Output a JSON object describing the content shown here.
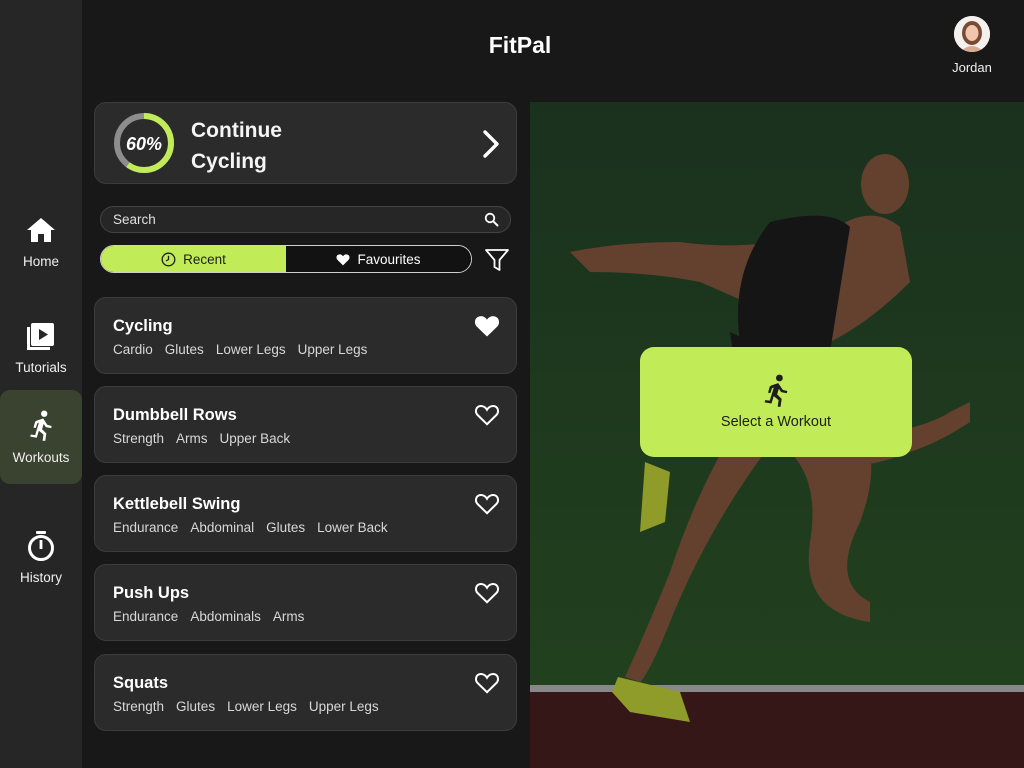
{
  "app": {
    "title": "FitPal"
  },
  "user": {
    "name": "Jordan",
    "avatar_icon": "avatar-portrait"
  },
  "sidebar": {
    "items": [
      {
        "label": "Home",
        "icon": "home-icon",
        "active": false
      },
      {
        "label": "Tutorials",
        "icon": "video-icon",
        "active": false
      },
      {
        "label": "Workouts",
        "icon": "running-icon",
        "active": true
      },
      {
        "label": "History",
        "icon": "stopwatch-icon",
        "active": false
      }
    ]
  },
  "continue_card": {
    "progress_percent": 60,
    "progress_label": "60%",
    "line1": "Continue",
    "line2": "Cycling"
  },
  "search": {
    "placeholder": "Search"
  },
  "tabs": {
    "recent_label": "Recent",
    "favourites_label": "Favourites",
    "active": "Recent"
  },
  "workouts": [
    {
      "name": "Cycling",
      "tags": [
        "Cardio",
        "Glutes",
        "Lower Legs",
        "Upper Legs"
      ],
      "favourite": true
    },
    {
      "name": "Dumbbell Rows",
      "tags": [
        "Strength",
        "Arms",
        "Upper Back"
      ],
      "favourite": false
    },
    {
      "name": "Kettlebell Swing",
      "tags": [
        "Endurance",
        "Abdominal",
        "Glutes",
        "Lower Back"
      ],
      "favourite": false
    },
    {
      "name": "Push Ups",
      "tags": [
        "Endurance",
        "Abdominals",
        "Arms"
      ],
      "favourite": false
    },
    {
      "name": "Squats",
      "tags": [
        "Strength",
        "Glutes",
        "Lower Legs",
        "Upper Legs"
      ],
      "favourite": false
    }
  ],
  "hero": {
    "cta_label": "Select a Workout",
    "cta_icon": "running-icon"
  },
  "colors": {
    "accent": "#c1ec58",
    "background": "#181818",
    "sidebar": "#262626",
    "card": "#2b2b2b",
    "active_nav": "#3a4230"
  }
}
